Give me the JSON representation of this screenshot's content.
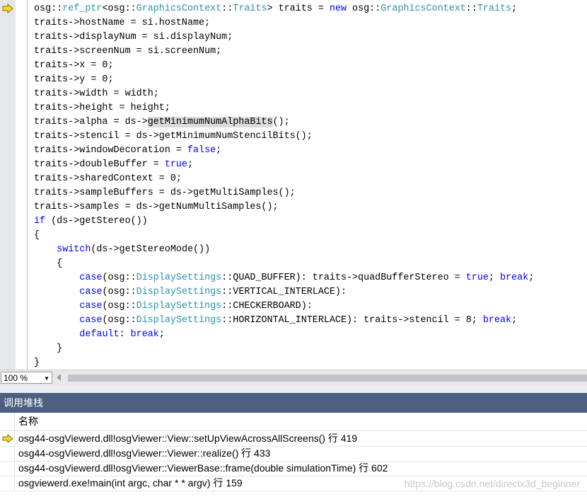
{
  "editor": {
    "lines": [
      [
        [
          "t",
          "osg::"
        ],
        [
          "ty",
          "ref_ptr"
        ],
        [
          "t",
          "<osg::"
        ],
        [
          "ty",
          "GraphicsContext"
        ],
        [
          "t",
          "::"
        ],
        [
          "ty",
          "Traits"
        ],
        [
          "t",
          "> traits = "
        ],
        [
          "kw",
          "new"
        ],
        [
          "t",
          " osg::"
        ],
        [
          "ty",
          "GraphicsContext"
        ],
        [
          "t",
          "::"
        ],
        [
          "ty",
          "Traits"
        ],
        [
          "t",
          ";"
        ]
      ],
      [
        [
          "t",
          "traits->hostName = si.hostName;"
        ]
      ],
      [
        [
          "t",
          "traits->displayNum = si.displayNum;"
        ]
      ],
      [
        [
          "t",
          "traits->screenNum = si.screenNum;"
        ]
      ],
      [
        [
          "t",
          "traits->x = 0;"
        ]
      ],
      [
        [
          "t",
          "traits->y = 0;"
        ]
      ],
      [
        [
          "t",
          "traits->width = width;"
        ]
      ],
      [
        [
          "t",
          "traits->height = height;"
        ]
      ],
      [
        [
          "t",
          "traits->alpha = ds->"
        ],
        [
          "hl",
          "getMinimumNumAlphaBits"
        ],
        [
          "t",
          "();"
        ]
      ],
      [
        [
          "t",
          "traits->stencil = ds->getMinimumNumStencilBits();"
        ]
      ],
      [
        [
          "t",
          "traits->windowDecoration = "
        ],
        [
          "kw",
          "false"
        ],
        [
          "t",
          ";"
        ]
      ],
      [
        [
          "t",
          "traits->doubleBuffer = "
        ],
        [
          "kw",
          "true"
        ],
        [
          "t",
          ";"
        ]
      ],
      [
        [
          "t",
          "traits->sharedContext = 0;"
        ]
      ],
      [
        [
          "t",
          "traits->sampleBuffers = ds->getMultiSamples();"
        ]
      ],
      [
        [
          "t",
          "traits->samples = ds->getNumMultiSamples();"
        ]
      ],
      [
        [
          "kw",
          "if"
        ],
        [
          "t",
          " (ds->getStereo())"
        ]
      ],
      [
        [
          "t",
          "{"
        ]
      ],
      [
        [
          "t",
          "    "
        ],
        [
          "kw",
          "switch"
        ],
        [
          "t",
          "(ds->getStereoMode())"
        ]
      ],
      [
        [
          "t",
          "    {"
        ]
      ],
      [
        [
          "t",
          "        "
        ],
        [
          "kw",
          "case"
        ],
        [
          "t",
          "(osg::"
        ],
        [
          "ty",
          "DisplaySettings"
        ],
        [
          "t",
          "::QUAD_BUFFER): traits->quadBufferStereo = "
        ],
        [
          "kw",
          "true"
        ],
        [
          "t",
          "; "
        ],
        [
          "kw",
          "break"
        ],
        [
          "t",
          ";"
        ]
      ],
      [
        [
          "t",
          "        "
        ],
        [
          "kw",
          "case"
        ],
        [
          "t",
          "(osg::"
        ],
        [
          "ty",
          "DisplaySettings"
        ],
        [
          "t",
          "::VERTICAL_INTERLACE):"
        ]
      ],
      [
        [
          "t",
          "        "
        ],
        [
          "kw",
          "case"
        ],
        [
          "t",
          "(osg::"
        ],
        [
          "ty",
          "DisplaySettings"
        ],
        [
          "t",
          "::CHECKERBOARD):"
        ]
      ],
      [
        [
          "t",
          "        "
        ],
        [
          "kw",
          "case"
        ],
        [
          "t",
          "(osg::"
        ],
        [
          "ty",
          "DisplaySettings"
        ],
        [
          "t",
          "::HORIZONTAL_INTERLACE): traits->stencil = 8; "
        ],
        [
          "kw",
          "break"
        ],
        [
          "t",
          ";"
        ]
      ],
      [
        [
          "t",
          "        "
        ],
        [
          "kw",
          "default"
        ],
        [
          "t",
          ": "
        ],
        [
          "kw",
          "break"
        ],
        [
          "t",
          ";"
        ]
      ],
      [
        [
          "t",
          "    }"
        ]
      ],
      [
        [
          "t",
          "}"
        ]
      ]
    ]
  },
  "statusbar": {
    "zoom": "100 %"
  },
  "callstack": {
    "title": "调用堆栈",
    "column": "名称",
    "rows": [
      "osg44-osgViewerd.dll!osgViewer::View::setUpViewAcrossAllScreens() 行 419",
      "osg44-osgViewerd.dll!osgViewer::Viewer::realize() 行 433",
      "osg44-osgViewerd.dll!osgViewer::ViewerBase::frame(double simulationTime) 行 602",
      "osgviewerd.exe!main(int argc, char * * argv) 行 159"
    ]
  },
  "watermark": "https://blog.csdn.net/directx3d_beginner",
  "colors": {
    "keyword": "#0000ff",
    "type": "#2b91af",
    "panel_title_bg": "#4d6082",
    "arrow": "#f5d62a"
  }
}
